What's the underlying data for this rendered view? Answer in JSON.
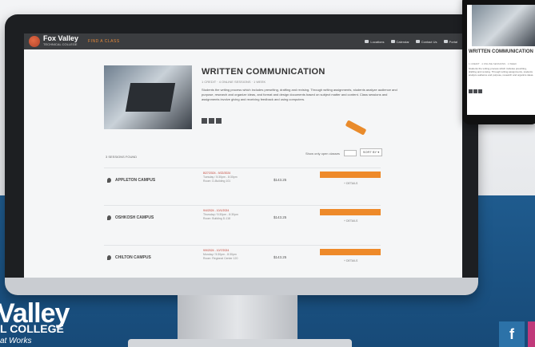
{
  "site": {
    "logo_name": "Fox Valley",
    "logo_sub": "TECHNICAL COLLEGE",
    "crumb": "FIND A CLASS",
    "nav": [
      "Locations",
      "Calendar",
      "Contact Us",
      "Portal"
    ]
  },
  "course": {
    "title": "WRITTEN COMMUNICATION",
    "meta": "1 CREDIT · 4 ONLINE SESSIONS · 1 WEEK",
    "description": "Students the writing process which includes prewriting, drafting and revising. Through writing assignments, students analyze audience and purpose, research and organize ideas, and format and design documents based on subject matter and content. Class sessions and assignments involve giving and receiving feedback and using computers."
  },
  "listing": {
    "count": "3 SESSIONS FOUND",
    "filter_label": "Show only open classes",
    "sort_label": "SORT BY ▾",
    "rows": [
      {
        "location": "APPLETON CAMPUS",
        "date": "8/27/2024 - 9/22/2024",
        "time": "Tuesday / 5:30pm - 8:30pm",
        "room": "Room: D-Building 101",
        "cost": "$143.25",
        "action": "REGISTER",
        "more": "+ DETAILS"
      },
      {
        "location": "OSHKOSH CAMPUS",
        "date": "9/4/2024 - 10/1/2024",
        "time": "Thursday / 5:30pm - 8:30pm",
        "room": "Room: Building D-118",
        "cost": "$143.25",
        "action": "REGISTER",
        "more": "+ DETAILS"
      },
      {
        "location": "CHILTON CAMPUS",
        "date": "9/9/2024 - 10/7/2024",
        "time": "Monday / 5:30pm - 8:30pm",
        "room": "Room: Regional Center 120",
        "cost": "$143.25",
        "action": "REGISTER",
        "more": "+ DETAILS"
      }
    ]
  },
  "mobile": {
    "title": "WRITTEN COMMUNICATION",
    "meta": "1 CREDIT · 4 ONLINE SESSIONS · 1 WEEK",
    "description": "Students the writing process which includes prewriting, drafting and revising. Through writing assignments, students analyze audience and purpose, research and organize ideas."
  },
  "brand": {
    "name": "Valley",
    "college": "L COLLEGE",
    "tagline": "at Works",
    "social": "f"
  },
  "colors": {
    "accent": "#ee8a2a",
    "header": "#3b3d40",
    "blue_band": "#1f5b8e"
  }
}
